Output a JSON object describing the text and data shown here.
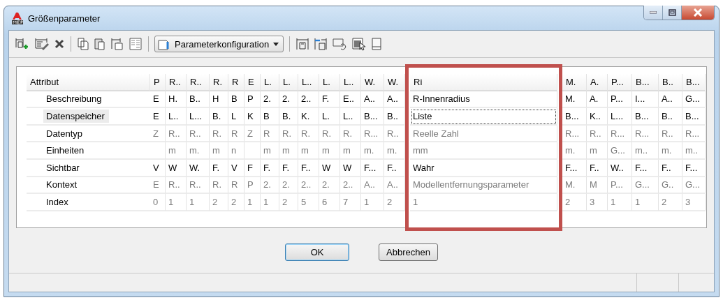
{
  "window": {
    "title": "Größenparameter"
  },
  "toolbar": {
    "dropdown": {
      "value": "Parameterkonfiguration"
    }
  },
  "table": {
    "attribute_header": "Attribut",
    "columns": [
      {
        "header": "P",
        "highlighted": false
      },
      {
        "header": "R..",
        "highlighted": false
      },
      {
        "header": "R..",
        "highlighted": false
      },
      {
        "header": "R.",
        "highlighted": false
      },
      {
        "header": "R",
        "highlighted": false
      },
      {
        "header": "E",
        "highlighted": false
      },
      {
        "header": "L.",
        "highlighted": false
      },
      {
        "header": "L.",
        "highlighted": false
      },
      {
        "header": "L..",
        "highlighted": false
      },
      {
        "header": "L.",
        "highlighted": false
      },
      {
        "header": "L..",
        "highlighted": false
      },
      {
        "header": "W.",
        "highlighted": false
      },
      {
        "header": "W.",
        "highlighted": false
      },
      {
        "header": "Ri",
        "highlighted": true
      },
      {
        "header": "M.",
        "highlighted": false
      },
      {
        "header": "A.",
        "highlighted": false
      },
      {
        "header": "P...",
        "highlighted": false
      },
      {
        "header": "B...",
        "highlighted": false
      },
      {
        "header": "B..",
        "highlighted": false
      },
      {
        "header": "B...",
        "highlighted": false
      }
    ],
    "rows": [
      {
        "attribute": "Beschreibung",
        "selected": false,
        "disabled": false,
        "cells": [
          "E",
          "H.",
          "B..",
          "H",
          "B",
          "P",
          "2.",
          "2.",
          "2..",
          "F.",
          "E..",
          "A..",
          "A..",
          "R-Innenradius",
          "M.",
          "A.",
          "P...",
          "I...",
          "A..",
          "G..."
        ]
      },
      {
        "attribute": "Datenspeicher",
        "selected": true,
        "disabled": false,
        "cells": [
          "E",
          "L..",
          "L...",
          "B.",
          "L",
          "K",
          "B",
          "B.",
          "K.",
          "L.",
          "L..",
          "B...",
          "B..",
          "Liste",
          "B...",
          "K..",
          "L...",
          "B...",
          "B..",
          "B..."
        ]
      },
      {
        "attribute": "Datentyp",
        "selected": false,
        "disabled": true,
        "cells": [
          "Z",
          "R..",
          "R..",
          "R.",
          "R",
          "Z",
          "R",
          "R.",
          "R.",
          "R.",
          "R.",
          "R...",
          "R..",
          "Reelle Zahl",
          "R...",
          "R..",
          "R...",
          "R...",
          "R..",
          "R..."
        ]
      },
      {
        "attribute": "Einheiten",
        "selected": false,
        "disabled": true,
        "cells": [
          null,
          "m",
          "m.",
          "m",
          "n",
          null,
          "m",
          "m",
          "m",
          "m",
          "m",
          "m.",
          "m.",
          "mm",
          "m.",
          "m",
          "G...",
          "m..",
          "m.",
          "m.."
        ]
      },
      {
        "attribute": "Sichtbar",
        "selected": false,
        "disabled": false,
        "cells": [
          "V",
          "W",
          "W.",
          "F.",
          "V",
          "F",
          "F.",
          "F.",
          "F..",
          "W",
          "W",
          "F...",
          "F..",
          "Wahr",
          "F...",
          "F..",
          "W..",
          "F...",
          "F..",
          "F..."
        ]
      },
      {
        "attribute": "Kontext",
        "selected": false,
        "disabled": true,
        "cells": [
          "E",
          "R..",
          "R..",
          "R.",
          "R",
          "P",
          "2.",
          "2.",
          "2..",
          "2.",
          "2..",
          "A..",
          "A..",
          "Modellentfernungsparameter",
          "M.",
          "M",
          "P...",
          "G...",
          "G..",
          "G..."
        ]
      },
      {
        "attribute": "Index",
        "selected": false,
        "disabled": true,
        "cells": [
          "0",
          "1",
          "1",
          "2",
          "2",
          "1",
          "1",
          "2",
          "5",
          "6",
          "7",
          "1",
          "2",
          "1",
          "2",
          "3",
          "1",
          "1",
          "2",
          "3"
        ]
      }
    ]
  },
  "buttons": [
    "OK",
    "Abbrechen"
  ]
}
